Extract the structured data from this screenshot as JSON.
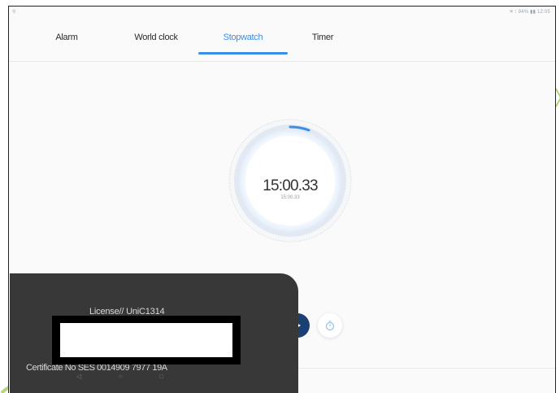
{
  "status_bar": {
    "left": "⚲",
    "right": "✳ ⁝ 94% ▮▮ 12:05"
  },
  "tabs": [
    {
      "label": "Alarm",
      "active": false
    },
    {
      "label": "World clock",
      "active": false
    },
    {
      "label": "Stopwatch",
      "active": true
    },
    {
      "label": "Timer",
      "active": false
    }
  ],
  "stopwatch": {
    "time": "15:00.33",
    "lap_time": "15:00.33"
  },
  "controls": {
    "reset_icon": "refresh-icon",
    "play_icon": "play-icon",
    "lap_icon": "timer-icon"
  },
  "overlay": {
    "license": "License// UniC1314",
    "certificate": "Certificate No SES 0014909 7977 19A"
  },
  "colors": {
    "accent": "#3b8ee8",
    "play_button": "#1c3f73",
    "overlay": "#383838",
    "decoration": "#b6d67a"
  }
}
